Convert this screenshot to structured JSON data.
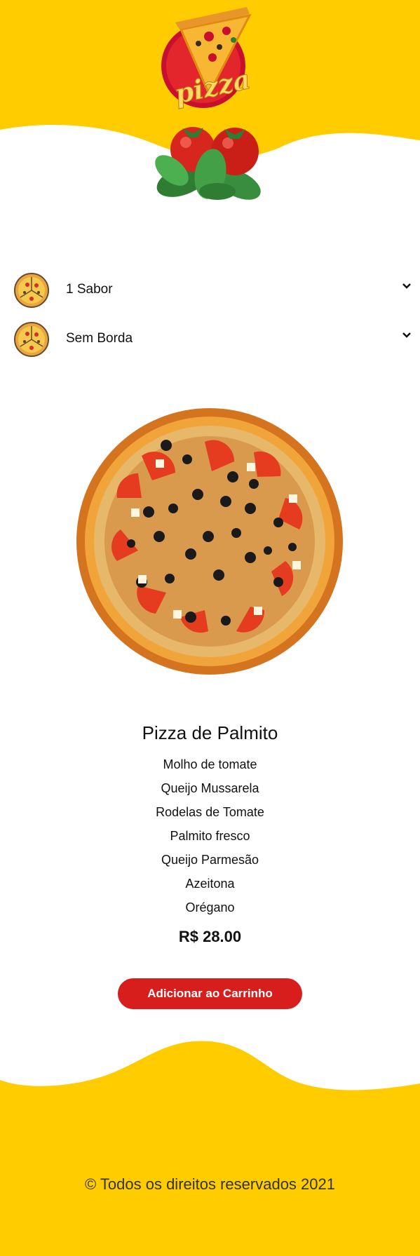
{
  "colors": {
    "brand_yellow": "#ffcc00",
    "accent_red": "#d81d1d",
    "text": "#111111"
  },
  "header": {
    "logo_text": "pizza"
  },
  "options": [
    {
      "label": "1 Sabor",
      "icon": "pizza-icon"
    },
    {
      "label": "Sem Borda",
      "icon": "pizza-icon"
    }
  ],
  "product": {
    "name": "Pizza de Palmito",
    "ingredients": [
      "Molho de tomate",
      "Queijo Mussarela",
      "Rodelas de Tomate",
      "Palmito fresco",
      "Queijo Parmesão",
      "Azeitona",
      "Orégano"
    ],
    "price": "R$ 28.00",
    "add_button": "Adicionar ao Carrinho"
  },
  "footer": {
    "copyright": "© Todos os direitos reservados 2021"
  }
}
